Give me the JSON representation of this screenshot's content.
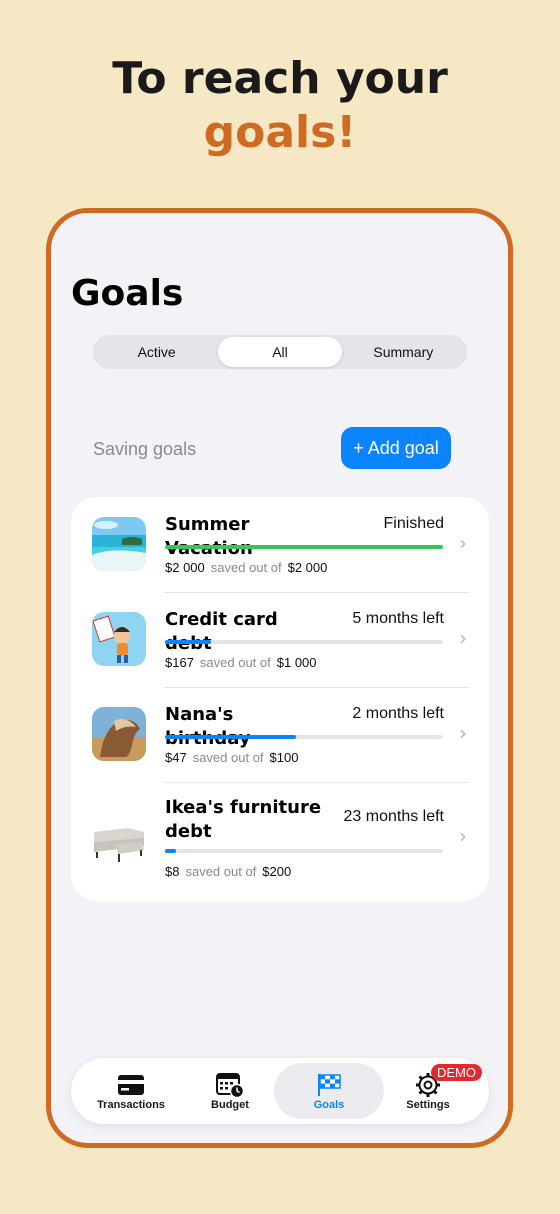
{
  "headline": {
    "line1": "To reach your",
    "line2": "goals!"
  },
  "page": {
    "title": "Goals"
  },
  "segments": [
    {
      "label": "Active"
    },
    {
      "label": "All",
      "selected": true
    },
    {
      "label": "Summary"
    }
  ],
  "section": {
    "label": "Saving goals",
    "add_button": "+ Add goal"
  },
  "goals": [
    {
      "name": "Summer Vacation",
      "status": "Finished",
      "saved": "$2 000",
      "saved_out_of": "saved out of",
      "target": "$2 000",
      "progress": 1.0,
      "bar_color": "#34c759",
      "image": "beach"
    },
    {
      "name": "Credit card debt",
      "status": "5 months left",
      "saved": "$167",
      "saved_out_of": "saved out of",
      "target": "$1 000",
      "progress": 0.167,
      "bar_color": "#0a84ff",
      "image": "debt-free"
    },
    {
      "name": "Nana's birthday",
      "status": "2 months left",
      "saved": "$47",
      "saved_out_of": "saved out of",
      "target": "$100",
      "progress": 0.47,
      "bar_color": "#0a84ff",
      "image": "horse"
    },
    {
      "name": "Ikea's furniture debt",
      "status": "23 months left",
      "saved": "$8",
      "saved_out_of": "saved out of",
      "target": "$200",
      "progress": 0.04,
      "bar_color": "#0a84ff",
      "image": "sofa"
    }
  ],
  "tabbar": {
    "tabs": [
      {
        "label": "Transactions",
        "icon": "card-icon"
      },
      {
        "label": "Budget",
        "icon": "calendar-clock-icon"
      },
      {
        "label": "Goals",
        "icon": "flag-icon",
        "active": true
      },
      {
        "label": "Settings",
        "icon": "gear-icon"
      }
    ],
    "demo_badge": "DEMO"
  },
  "colors": {
    "accent": "#cf6a22",
    "blue": "#0a84ff",
    "green": "#34c759",
    "background": "#f6e7c5"
  }
}
